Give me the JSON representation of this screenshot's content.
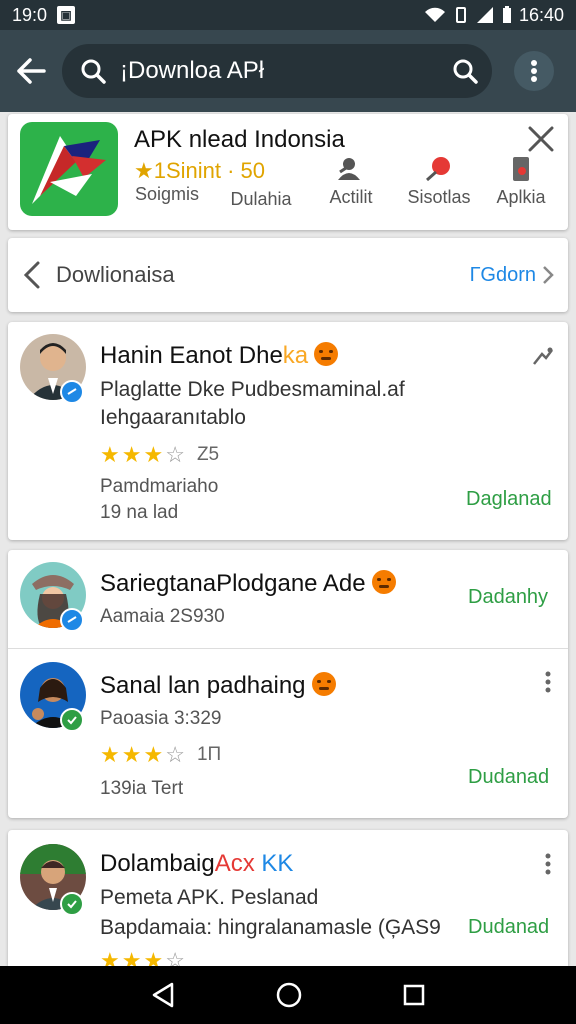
{
  "status": {
    "time": "19:0",
    "right_time": "16:40"
  },
  "search": {
    "query": "¡Downloa APł"
  },
  "app": {
    "name": "APK nlead Indonsia",
    "rating": "★1Sinint · 50",
    "stats": [
      {
        "label": "Soigmis",
        "icon": "grid-icon"
      },
      {
        "label": "Dulahia",
        "icon": "shield-icon"
      },
      {
        "label": "Actilit",
        "icon": "person-icon"
      },
      {
        "label": "Sisotlas",
        "icon": "pin-icon"
      },
      {
        "label": "Aplkia",
        "icon": "phone-icon"
      }
    ]
  },
  "more": {
    "title": "Dowlionaisa",
    "link": "ГGdorn"
  },
  "reviews": [
    {
      "name": "Hanin Eanot Dhe",
      "name_accent": "ka",
      "line1": "Plaglatte Dke Pudbesmaminal.af",
      "line2": "Iehgaaranıtablo",
      "rating": "Z5",
      "meta1": "Pamdmariaho",
      "meta2": "19 na lad",
      "action": "Daglanad"
    },
    {
      "name": "SariegtanaPlodgane Ade",
      "sub": "Aamaia 2S930",
      "action": "Dadanhy"
    },
    {
      "name": "Sanal lan padhaing",
      "sub": "Paoasia 3:329",
      "rating": "1П",
      "meta": "139ia Tert",
      "action": "Dudanad"
    },
    {
      "name": "Dolambaig",
      "name_accent": "Acx",
      "name_accent2": "KK",
      "line1": "Pemeta APK. Peslanad",
      "line2": "Bapdamaia: hingralanamasle (ĢAS9",
      "action": "Dudanad"
    }
  ],
  "colors": {
    "accent_green": "#2e9e44",
    "link_blue": "#1e88e5",
    "star": "#f5b800",
    "appbar": "#37474f"
  }
}
